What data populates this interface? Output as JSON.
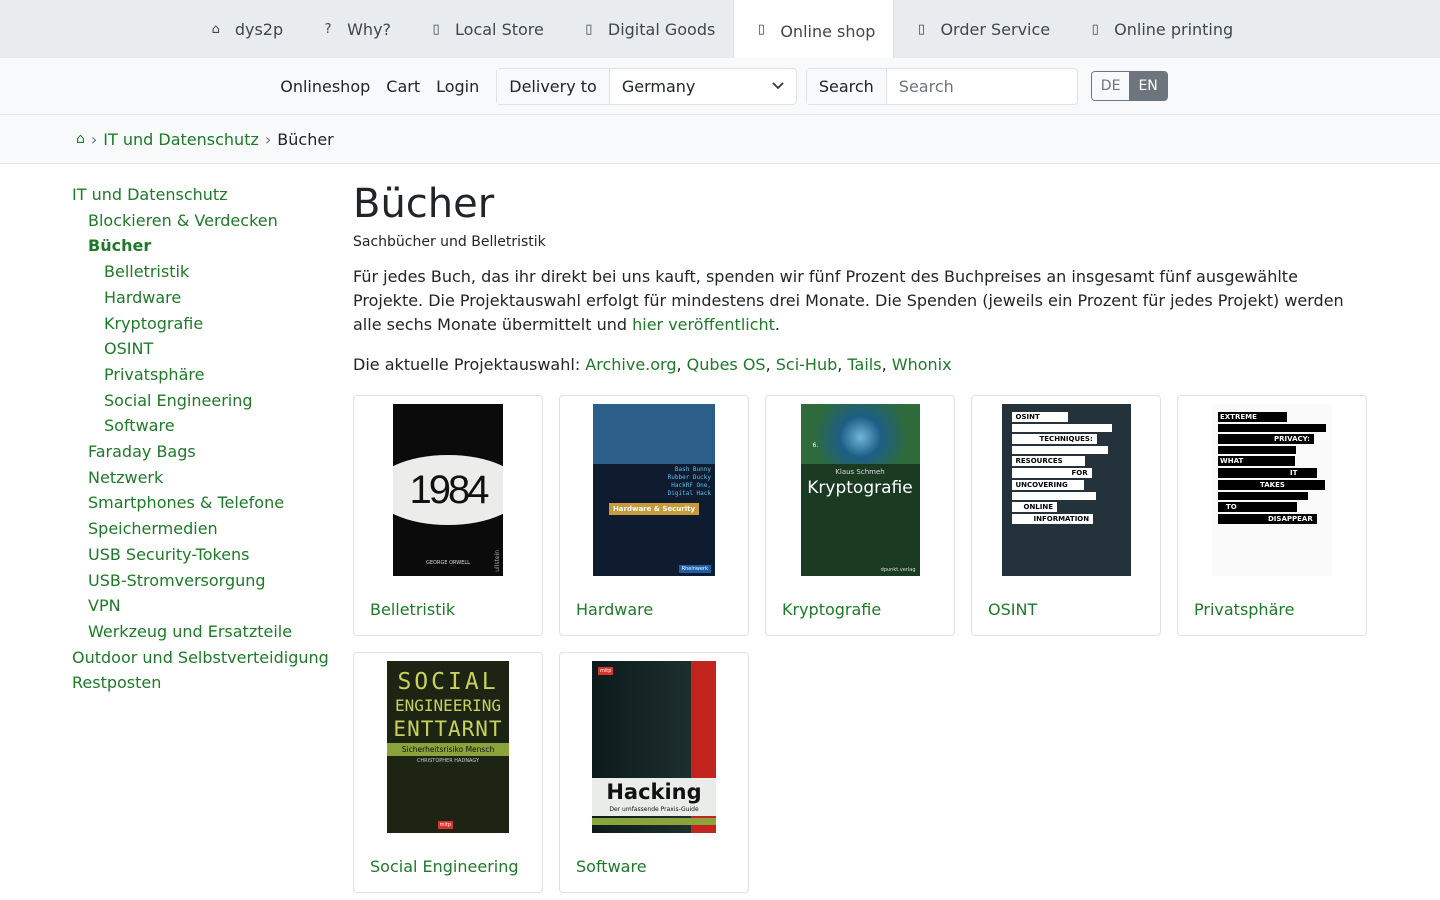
{
  "topnav": {
    "tabs": [
      {
        "label": "dys2p",
        "icon": "home-icon"
      },
      {
        "label": "Why?",
        "icon": "question-icon"
      },
      {
        "label": "Local Store",
        "icon": "store-icon"
      },
      {
        "label": "Digital Goods",
        "icon": "download-icon"
      },
      {
        "label": "Online shop",
        "icon": "cart-icon",
        "active": true
      },
      {
        "label": "Order Service",
        "icon": "box-icon"
      },
      {
        "label": "Online printing",
        "icon": "printer-icon"
      }
    ]
  },
  "subbar": {
    "onlineshop": "Onlineshop",
    "cart": "Cart",
    "login": "Login",
    "delivery_label": "Delivery to",
    "delivery_value": "Germany",
    "search_label": "Search",
    "search_placeholder": "Search",
    "lang_de": "DE",
    "lang_en": "EN"
  },
  "breadcrumb": {
    "home_icon": "home-icon",
    "parent": "IT und Datenschutz",
    "current": "Bücher"
  },
  "sidebar": {
    "items": [
      {
        "label": "IT und Datenschutz"
      },
      {
        "label": "Blockieren & Verdecken"
      },
      {
        "label": "Bücher"
      },
      {
        "label": "Belletristik"
      },
      {
        "label": "Hardware"
      },
      {
        "label": "Kryptografie"
      },
      {
        "label": "OSINT"
      },
      {
        "label": "Privatsphäre"
      },
      {
        "label": "Social Engineering"
      },
      {
        "label": "Software"
      },
      {
        "label": "Faraday Bags"
      },
      {
        "label": "Netzwerk"
      },
      {
        "label": "Smartphones & Telefone"
      },
      {
        "label": "Speichermedien"
      },
      {
        "label": "USB Security-Tokens"
      },
      {
        "label": "USB-Stromversorgung"
      },
      {
        "label": "VPN"
      },
      {
        "label": "Werkzeug und Ersatzteile"
      },
      {
        "label": "Outdoor und Selbstverteidigung"
      },
      {
        "label": "Restposten"
      }
    ]
  },
  "content": {
    "title": "Bücher",
    "subtitle": "Sachbücher und Belletristik",
    "paragraph": "Für jedes Buch, das ihr direkt bei uns kauft, spenden wir fünf Prozent des Buchpreises an insgesamt fünf ausgewählte Projekte. Die Projektauswahl erfolgt für mindestens drei Monate. Die Spenden (jeweils ein Prozent für jedes Projekt) werden alle sechs Monate übermittelt und",
    "paragraph_link": "hier veröffentlicht",
    "paragraph_end": ".",
    "projects_intro": "Die aktuelle Projektauswahl: ",
    "projects": [
      "Archive.org",
      "Qubes OS",
      "Sci-Hub",
      "Tails",
      "Whonix"
    ],
    "cards": [
      {
        "label": "Belletristik",
        "cover_title": "1984",
        "cover_author": "GEORGE ORWELL",
        "cover_publisher": "ullstein"
      },
      {
        "label": "Hardware",
        "cover_title": "Hardware & Security",
        "cover_lines": [
          "Bash Bunny",
          "Rubber Ducky",
          "HackRF One,",
          "Digital Hack"
        ],
        "cover_publisher": "Rheinwerk"
      },
      {
        "label": "Kryptografie",
        "cover_title": "Kryptografie",
        "cover_author": "Klaus Schmeh",
        "cover_edition": "6.",
        "cover_publisher": "dpunkt.verlag"
      },
      {
        "label": "OSINT",
        "cover_title": "OSINT TECHNIQUES: RESOURCES FOR UNCOVERING ONLINE INFORMATION",
        "cover_words": [
          "OSINT",
          "TECHNIQUES:",
          "RESOURCES",
          "FOR",
          "UNCOVERING",
          "ONLINE",
          "INFORMATION"
        ]
      },
      {
        "label": "Privatsphäre",
        "cover_title": "EXTREME PRIVACY: WHAT IT TAKES TO DISAPPEAR",
        "cover_words": [
          "EXTREME",
          "PRIVACY:",
          "WHAT",
          "IT",
          "TAKES",
          "TO",
          "DISAPPEAR"
        ]
      },
      {
        "label": "Social Engineering",
        "cover_words": [
          "SOCIAL",
          "ENGINEERING",
          "ENTTARNT"
        ],
        "cover_band": "Sicherheitsrisiko Mensch",
        "cover_author": "CHRISTOPHER HADNAGY",
        "cover_publisher": "mitp"
      },
      {
        "label": "Software",
        "cover_title": "Hacking",
        "cover_subtitle": "Der umfassende Praxis-Guide",
        "cover_publisher": "mitp"
      }
    ]
  },
  "colors": {
    "link": "#1e7a28",
    "topbar_bg": "#e9ecef",
    "subbar_bg": "#f8f9fa"
  }
}
